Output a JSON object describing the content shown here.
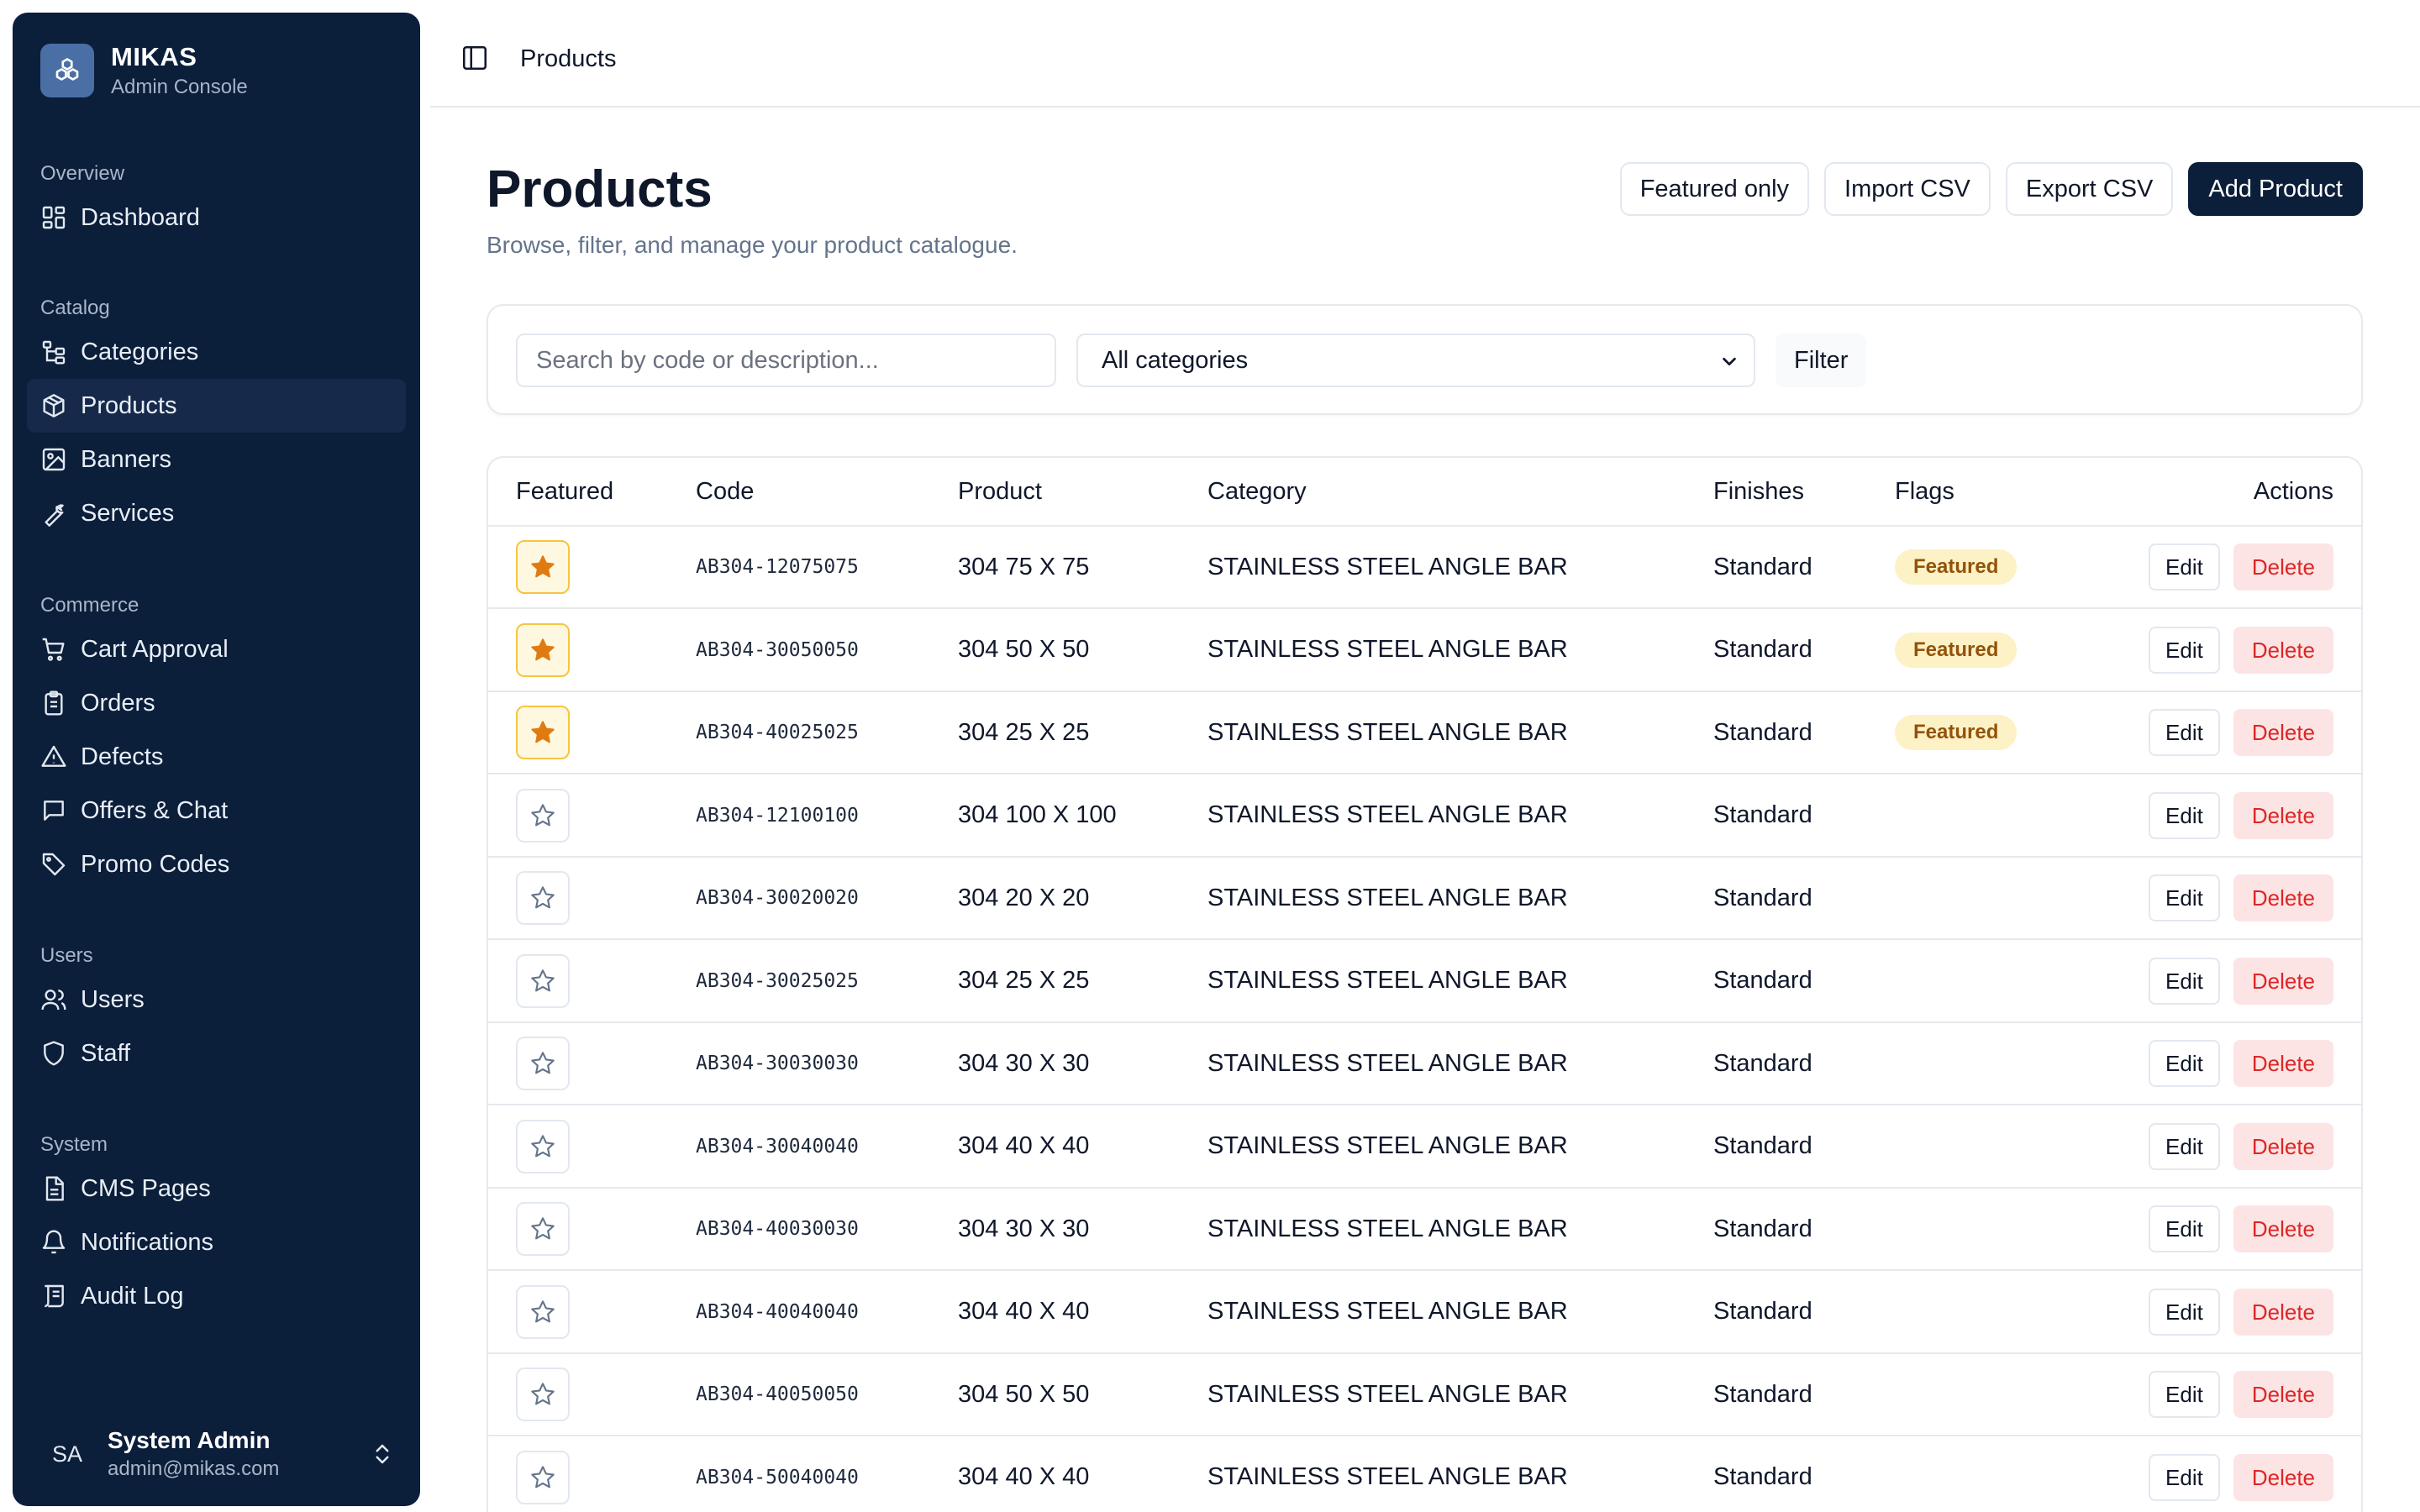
{
  "brand": {
    "name": "MIKAS",
    "subtitle": "Admin Console",
    "logo_icon": "cubes-icon"
  },
  "nav": {
    "overview": {
      "heading": "Overview",
      "items": [
        {
          "label": "Dashboard",
          "icon": "dashboard-icon"
        }
      ]
    },
    "catalog": {
      "heading": "Catalog",
      "items": [
        {
          "label": "Categories",
          "icon": "tree-icon"
        },
        {
          "label": "Products",
          "icon": "package-icon",
          "active": true
        },
        {
          "label": "Banners",
          "icon": "image-icon"
        },
        {
          "label": "Services",
          "icon": "wrench-icon"
        }
      ]
    },
    "commerce": {
      "heading": "Commerce",
      "items": [
        {
          "label": "Cart Approval",
          "icon": "cart-icon"
        },
        {
          "label": "Orders",
          "icon": "clipboard-icon"
        },
        {
          "label": "Defects",
          "icon": "warning-icon"
        },
        {
          "label": "Offers & Chat",
          "icon": "chat-icon"
        },
        {
          "label": "Promo Codes",
          "icon": "tag-icon"
        }
      ]
    },
    "users": {
      "heading": "Users",
      "items": [
        {
          "label": "Users",
          "icon": "users-icon"
        },
        {
          "label": "Staff",
          "icon": "shield-icon"
        }
      ]
    },
    "system": {
      "heading": "System",
      "items": [
        {
          "label": "CMS Pages",
          "icon": "file-icon"
        },
        {
          "label": "Notifications",
          "icon": "bell-icon"
        },
        {
          "label": "Audit Log",
          "icon": "log-icon"
        }
      ]
    }
  },
  "user": {
    "initials": "SA",
    "name": "System Admin",
    "email": "admin@mikas.com"
  },
  "topbar": {
    "breadcrumb": "Products"
  },
  "header": {
    "title": "Products",
    "subtitle": "Browse, filter, and manage your product catalogue.",
    "buttons": {
      "featured_only": "Featured only",
      "import": "Import CSV",
      "export": "Export CSV",
      "add": "Add Product"
    }
  },
  "filters": {
    "search_placeholder": "Search by code or description...",
    "category_selected": "All categories",
    "filter_button": "Filter"
  },
  "table": {
    "columns": {
      "featured": "Featured",
      "code": "Code",
      "product": "Product",
      "category": "Category",
      "finishes": "Finishes",
      "flags": "Flags",
      "actions": "Actions"
    },
    "edit_label": "Edit",
    "delete_label": "Delete",
    "rows": [
      {
        "featured": true,
        "code": "AB304-12075075",
        "product": "304 75 X 75",
        "category": "STAINLESS STEEL ANGLE BAR",
        "finishes": "Standard",
        "flag": "Featured"
      },
      {
        "featured": true,
        "code": "AB304-30050050",
        "product": "304 50 X 50",
        "category": "STAINLESS STEEL ANGLE BAR",
        "finishes": "Standard",
        "flag": "Featured"
      },
      {
        "featured": true,
        "code": "AB304-40025025",
        "product": "304 25 X 25",
        "category": "STAINLESS STEEL ANGLE BAR",
        "finishes": "Standard",
        "flag": "Featured"
      },
      {
        "featured": false,
        "code": "AB304-12100100",
        "product": "304 100 X 100",
        "category": "STAINLESS STEEL ANGLE BAR",
        "finishes": "Standard",
        "flag": ""
      },
      {
        "featured": false,
        "code": "AB304-30020020",
        "product": "304 20 X 20",
        "category": "STAINLESS STEEL ANGLE BAR",
        "finishes": "Standard",
        "flag": ""
      },
      {
        "featured": false,
        "code": "AB304-30025025",
        "product": "304 25 X 25",
        "category": "STAINLESS STEEL ANGLE BAR",
        "finishes": "Standard",
        "flag": ""
      },
      {
        "featured": false,
        "code": "AB304-30030030",
        "product": "304 30 X 30",
        "category": "STAINLESS STEEL ANGLE BAR",
        "finishes": "Standard",
        "flag": ""
      },
      {
        "featured": false,
        "code": "AB304-30040040",
        "product": "304 40 X 40",
        "category": "STAINLESS STEEL ANGLE BAR",
        "finishes": "Standard",
        "flag": ""
      },
      {
        "featured": false,
        "code": "AB304-40030030",
        "product": "304 30 X 30",
        "category": "STAINLESS STEEL ANGLE BAR",
        "finishes": "Standard",
        "flag": ""
      },
      {
        "featured": false,
        "code": "AB304-40040040",
        "product": "304 40 X 40",
        "category": "STAINLESS STEEL ANGLE BAR",
        "finishes": "Standard",
        "flag": ""
      },
      {
        "featured": false,
        "code": "AB304-40050050",
        "product": "304 50 X 50",
        "category": "STAINLESS STEEL ANGLE BAR",
        "finishes": "Standard",
        "flag": ""
      },
      {
        "featured": false,
        "code": "AB304-50040040",
        "product": "304 40 X 40",
        "category": "STAINLESS STEEL ANGLE BAR",
        "finishes": "Standard",
        "flag": ""
      }
    ]
  },
  "colors": {
    "sidebar_bg": "#0b1e3a",
    "primary": "#0b1e3a",
    "star_on": "#e07b12",
    "danger": "#dc2626",
    "badge_bg": "#fdf1c6"
  }
}
